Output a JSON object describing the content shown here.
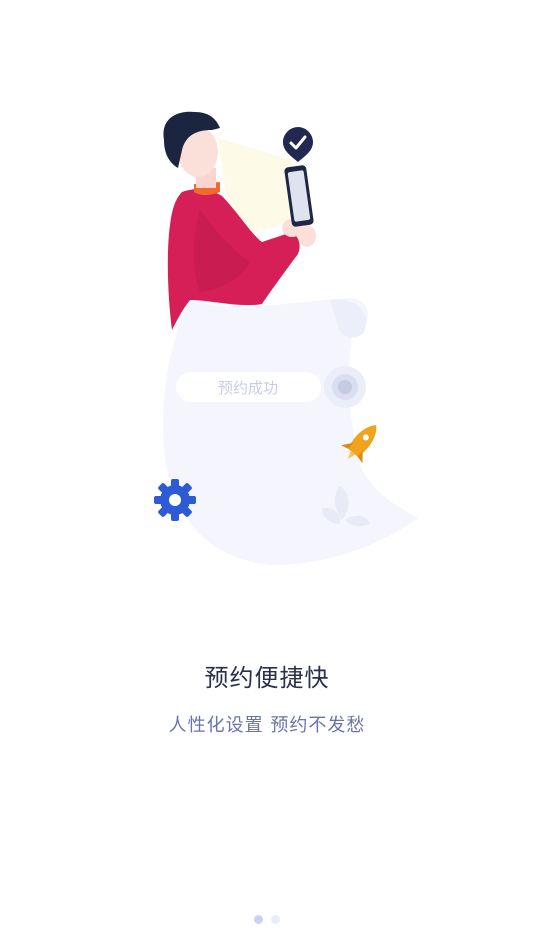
{
  "onboarding": {
    "illustration": {
      "bubble_text": "预约成功",
      "icons": [
        "check-badge-icon",
        "phone-icon",
        "target-icon",
        "rocket-icon",
        "gear-icon",
        "plant-icon"
      ]
    },
    "title": "预约便捷快",
    "subtitle": "人性化设置 预约不发愁",
    "pager": {
      "total": 2,
      "current": 1
    }
  },
  "colors": {
    "background": "#ffffff",
    "title": "#2a2f4a",
    "subtitle": "#6b74a8",
    "shirt": "#d81f5a",
    "hair": "#1c2540",
    "check_badge": "#22284f",
    "rocket": "#f0a31c",
    "gear": "#2d5bd3",
    "paper": "#f4f6fd",
    "dot_active": "#c9d3ee",
    "dot_inactive": "#eaedf7"
  }
}
